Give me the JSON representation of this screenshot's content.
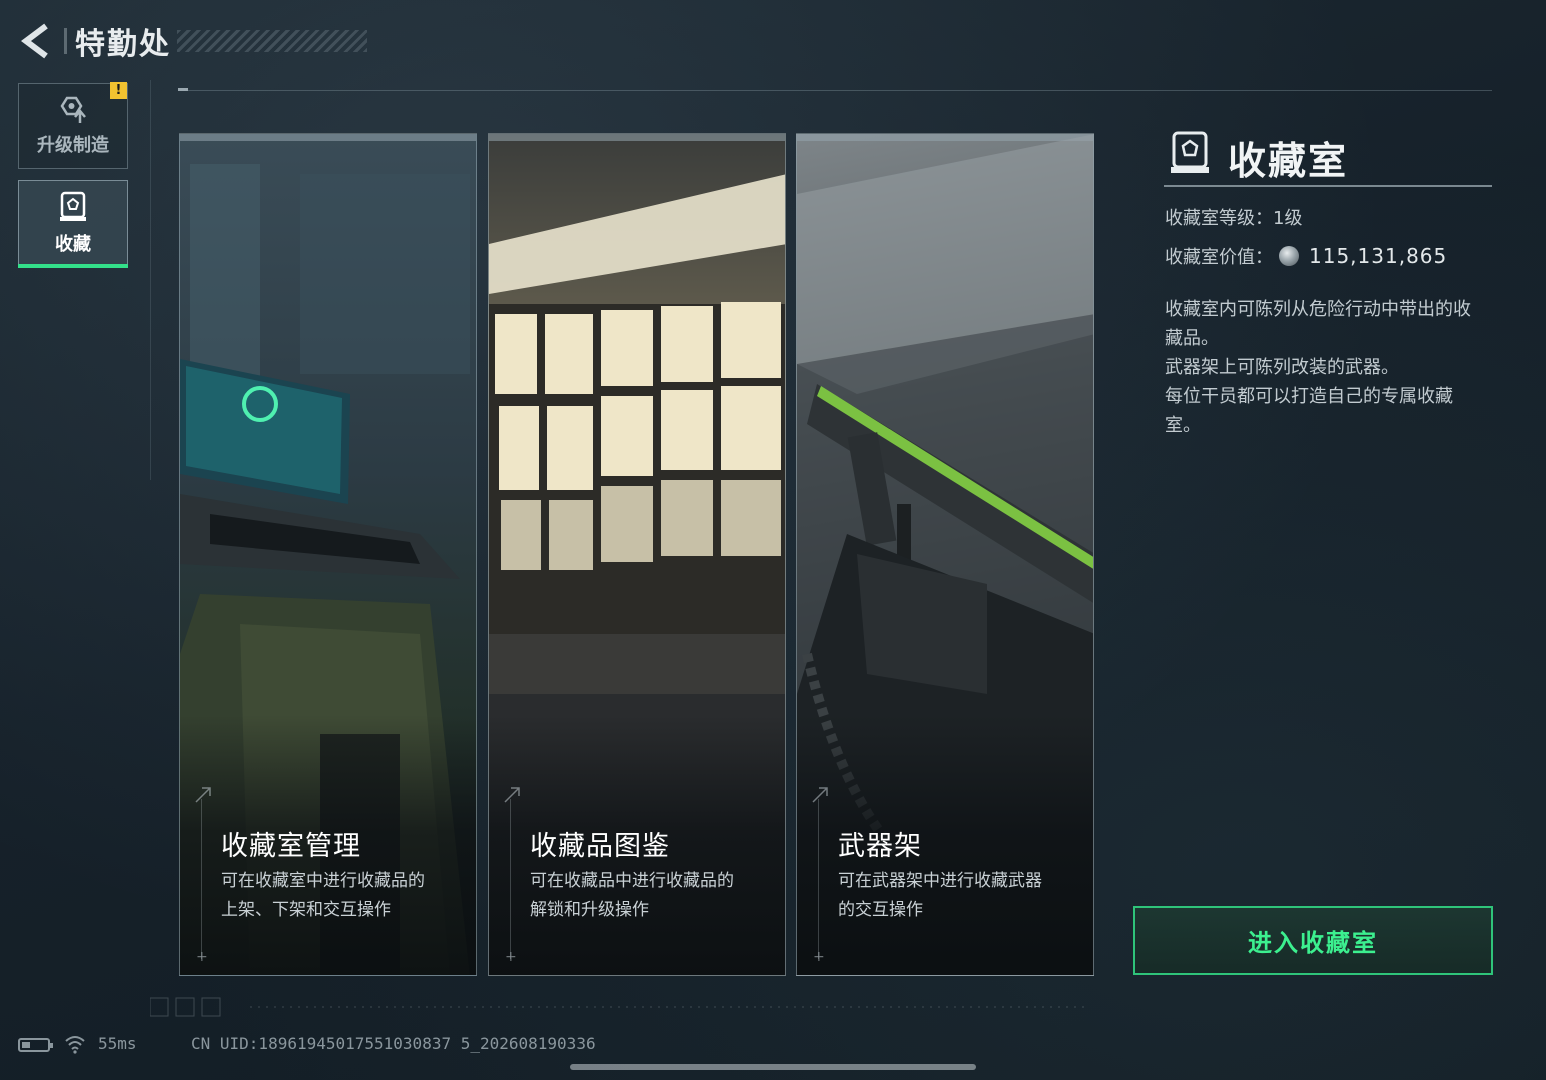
{
  "header": {
    "title": "特勤处"
  },
  "sidebar": {
    "items": [
      {
        "label": "升级制造",
        "icon": "upgrade-craft-icon",
        "alert": "!",
        "selected": false
      },
      {
        "label": "收藏",
        "icon": "collection-room-icon",
        "selected": true
      }
    ]
  },
  "cards": [
    {
      "title": "收藏室管理",
      "desc": "可在收藏室中进行收藏品的\n上架、下架和交互操作"
    },
    {
      "title": "收藏品图鉴",
      "desc": "可在收藏品中进行收藏品的\n解锁和升级操作"
    },
    {
      "title": "武器架",
      "desc": "可在武器架中进行收藏武器\n的交互操作"
    }
  ],
  "panel": {
    "title": "收藏室",
    "level_label": "收藏室等级：1级",
    "value_label": "收藏室价值：",
    "value": "115,131,865",
    "description": [
      "收藏室内可陈列从危险行动中带出的收藏品。",
      "武器架上可陈列改装的武器。",
      "每位干员都可以打造自己的专属收藏室。"
    ],
    "enter_button": "进入收藏室"
  },
  "status": {
    "ping": "55ms",
    "uid": "CN UID:18961945017551030837 5_202608190336",
    "battery_level": 0.35
  },
  "colors": {
    "accent": "#33e08a",
    "alert": "#f2c230",
    "button_text": "#3cf08f"
  }
}
